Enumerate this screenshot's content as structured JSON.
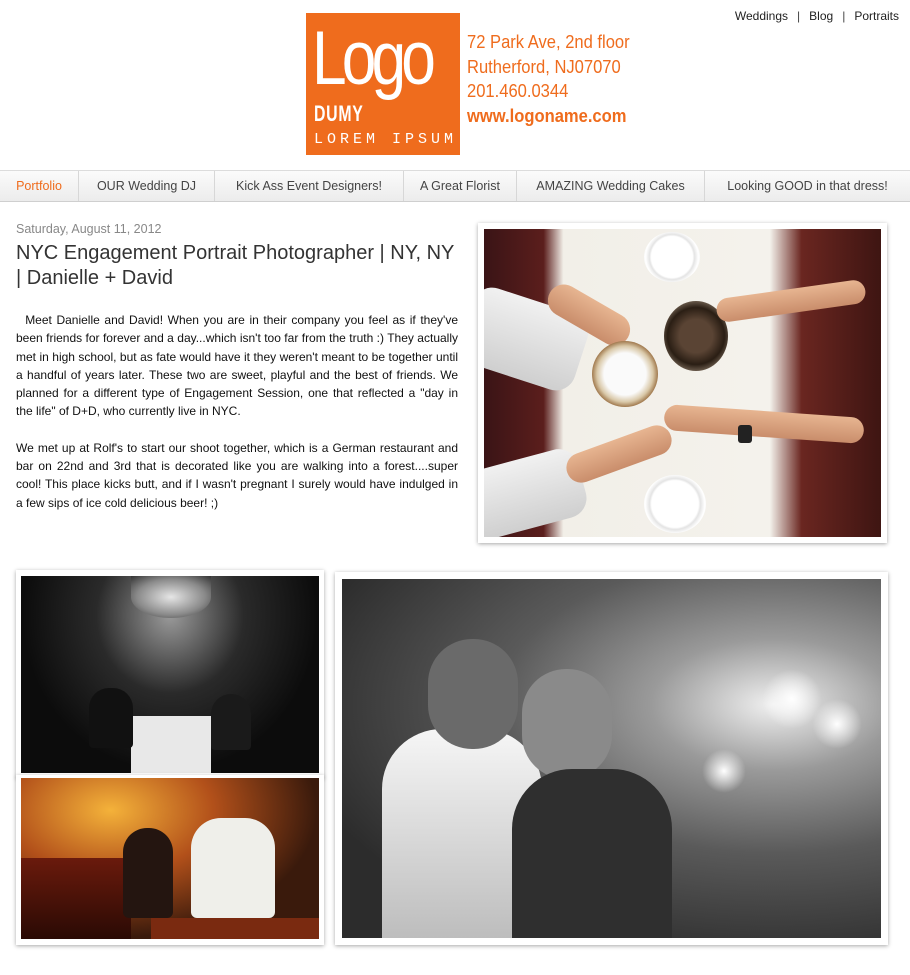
{
  "top_links": [
    "Weddings",
    "Blog",
    "Portraits"
  ],
  "top_sep": "|",
  "logo": {
    "main": "Logo",
    "dumy": "DUMY",
    "sub": "LOREM IPSUM"
  },
  "contact": {
    "address1": "72 Park Ave, 2nd floor",
    "address2": "Rutherford, NJ07070",
    "phone": "201.460.0344",
    "website": "www.logoname.com"
  },
  "nav": {
    "items": [
      {
        "label": "Portfolio"
      },
      {
        "label": "OUR Wedding DJ"
      },
      {
        "label": "Kick Ass Event Designers!"
      },
      {
        "label": "A Great Florist"
      },
      {
        "label": "AMAZING Wedding Cakes"
      },
      {
        "label": "Looking GOOD in that dress!"
      }
    ]
  },
  "post": {
    "date": "Saturday, August 11, 2012",
    "title": "NYC Engagement Portrait Photographer | NY, NY | Danielle + David",
    "paragraphs": [
      "Meet Danielle and David!  When you are in their company you feel as if they've been friends for forever and a day...which isn't too far from the truth :)  They actually met in high school, but as fate would have it they weren't meant to be together until a handful of years later.  These two are sweet, playful and the best of friends.  We planned for a different type of Engagement Session, one that reflected a \"day in the life\" of D+D, who currently live in NYC.",
      "We met up at Rolf's to start our shoot together, which is a German restaurant and bar on 22nd and 3rd that is decorated like you are walking into a forest....super cool!  This place kicks butt, and if I wasn't pregnant I surely would have indulged in a few sips of ice cold delicious beer! ;)"
    ]
  },
  "colors": {
    "accent": "#ef6c1d"
  }
}
